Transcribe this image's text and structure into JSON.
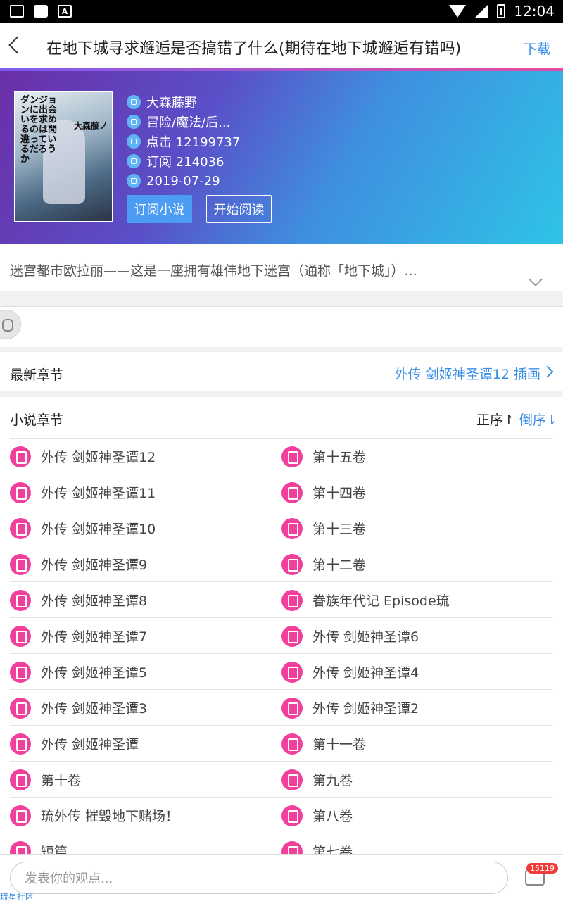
{
  "status": {
    "time": "12:04"
  },
  "header": {
    "title": "在地下城寻求邂逅是否搞错了什么(期待在地下城邂逅有错吗)",
    "download": "下载"
  },
  "book": {
    "cover_text_a": "ダンジョンに出会いを求めるのは間違っているだろうか",
    "cover_text_b": "大森藤ノ",
    "author": "大森藤野",
    "genre": "冒险/魔法/后...",
    "clicks": "点击 12199737",
    "subscriptions": "订阅 214036",
    "date": "2019-07-29",
    "subscribe_label": "订阅小说",
    "read_label": "开始阅读"
  },
  "intro": {
    "text": "迷宫都市欧拉丽——这是一座拥有雄伟地下迷宫（通称「地下城」）..."
  },
  "latest": {
    "label": "最新章节",
    "value": "外传 剑姬神圣谭12 插画"
  },
  "chapters": {
    "title": "小说章节",
    "sort_asc": "正序↾",
    "sort_desc": "倒序⇂",
    "rows": [
      {
        "left": "外传 剑姬神圣谭12",
        "right": "第十五卷"
      },
      {
        "left": "外传 剑姬神圣谭11",
        "right": "第十四卷"
      },
      {
        "left": "外传 剑姬神圣谭10",
        "right": "第十三卷"
      },
      {
        "left": "外传 剑姬神圣谭9",
        "right": "第十二卷"
      },
      {
        "left": "外传 剑姬神圣谭8",
        "right": "眷族年代记 Episode琉"
      },
      {
        "left": "外传 剑姬神圣谭7",
        "right": "外传 剑姬神圣谭6"
      },
      {
        "left": "外传 剑姬神圣谭5",
        "right": "外传 剑姬神圣谭4"
      },
      {
        "left": "外传 剑姬神圣谭3",
        "right": "外传 剑姬神圣谭2"
      },
      {
        "left": "外传 剑姬神圣谭",
        "right": "第十一卷"
      },
      {
        "left": "第十卷",
        "right": "第九卷"
      },
      {
        "left": "琉外传 摧毁地下赌场！",
        "right": "第八卷"
      },
      {
        "left": "短篇",
        "right": "第七卷"
      }
    ]
  },
  "comment": {
    "placeholder": "发表你的观点...",
    "count": "15119",
    "community": "琉星社区"
  }
}
